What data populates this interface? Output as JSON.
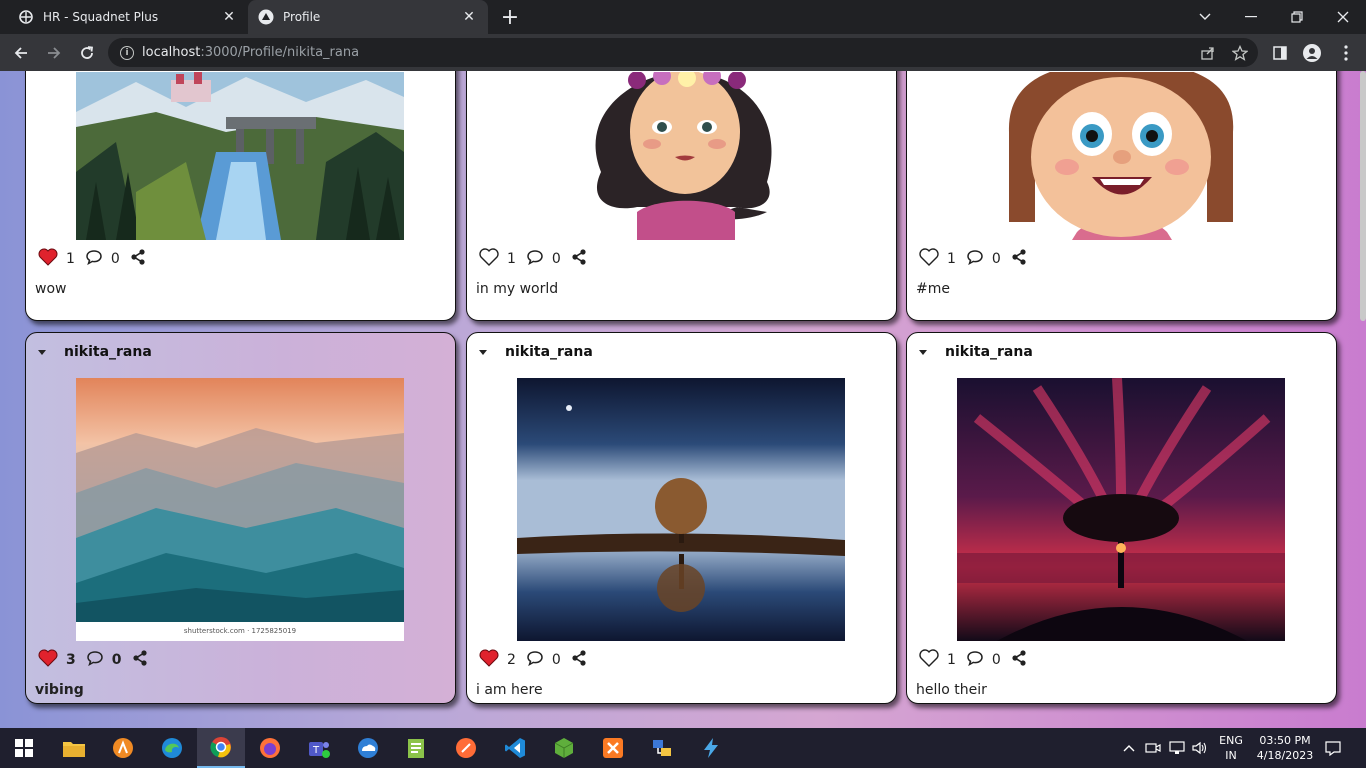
{
  "browser": {
    "tabs": [
      {
        "title": "HR - Squadnet Plus",
        "active": false
      },
      {
        "title": "Profile",
        "active": true
      }
    ],
    "url_host": "localhost",
    "url_rest": ":3000/Profile/nikita_rana"
  },
  "posts_row1": [
    {
      "likes": "1",
      "liked": true,
      "comments": "0",
      "caption": "wow",
      "image": "pixel-waterfall-castle"
    },
    {
      "likes": "1",
      "liked": false,
      "comments": "0",
      "caption": "in my world",
      "image": "cartoon-girl-flower-crown"
    },
    {
      "likes": "1",
      "liked": false,
      "comments": "0",
      "caption": "#me",
      "image": "cartoon-girl-smiling"
    }
  ],
  "posts_row2": [
    {
      "username": "nikita_rana",
      "likes": "3",
      "liked": true,
      "comments": "0",
      "caption": "vibing",
      "image": "misty-mountains",
      "watermark": "shutterstock.com · 1725825019"
    },
    {
      "username": "nikita_rana",
      "likes": "2",
      "liked": true,
      "comments": "0",
      "caption": "i am here",
      "image": "tree-reflection-night"
    },
    {
      "username": "nikita_rana",
      "likes": "1",
      "liked": false,
      "comments": "0",
      "caption": "hello their",
      "image": "tree-red-sky"
    }
  ],
  "taskbar": {
    "language": "ENG",
    "region": "IN",
    "time": "03:50 PM",
    "date": "4/18/2023"
  },
  "colors": {
    "heart_red": "#e0222d",
    "page_gradient_start": "#8a93d6",
    "page_gradient_end": "#c97ccf"
  }
}
